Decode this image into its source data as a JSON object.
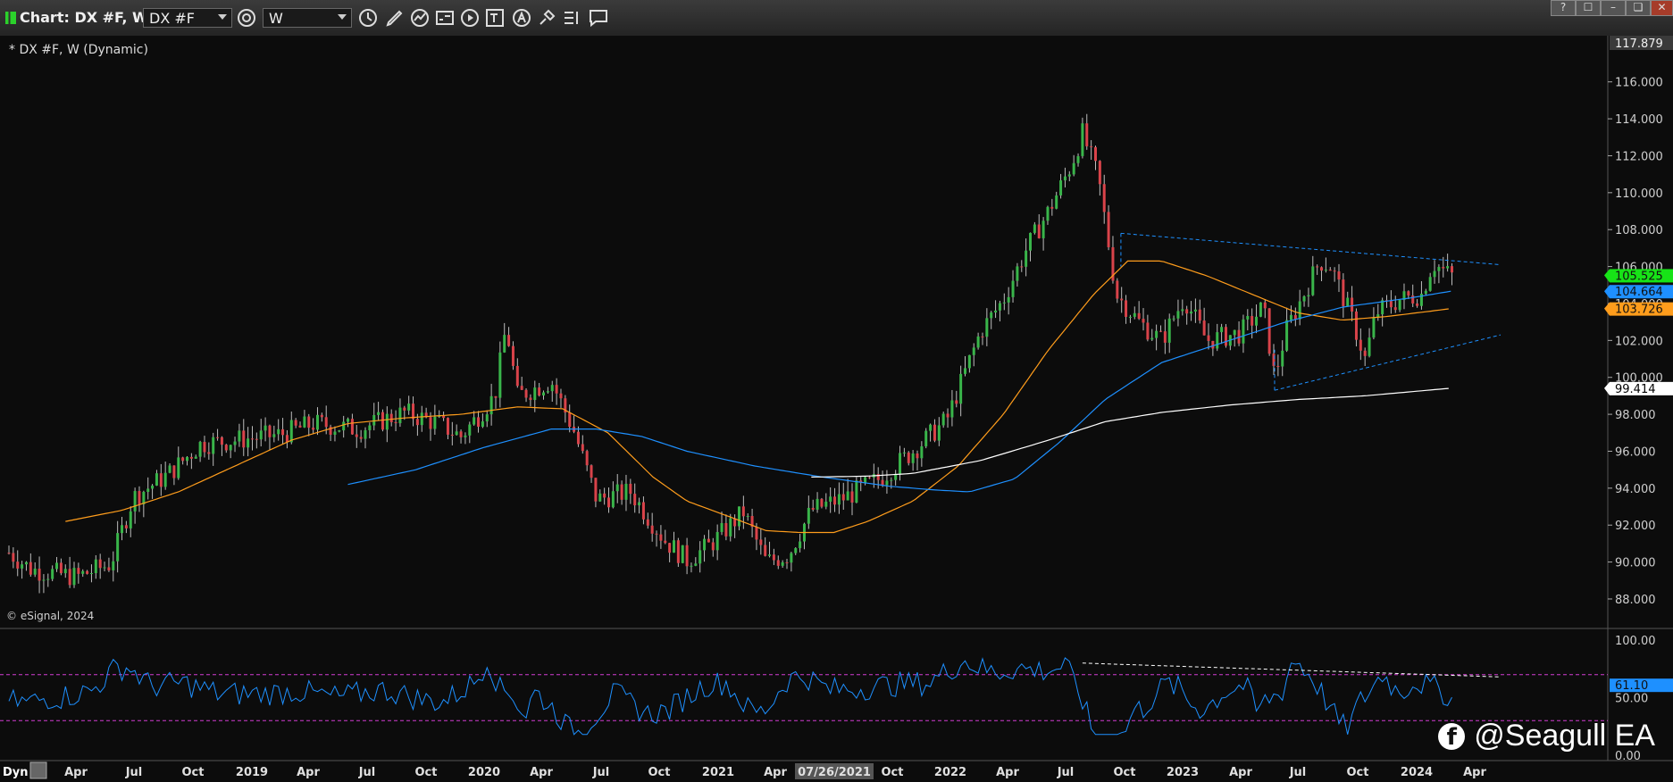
{
  "window": {
    "title": "Chart: DX #F, W",
    "symbol_value": "DX #F",
    "interval_value": "W",
    "buttons": [
      "?",
      "☐",
      "–",
      "❏",
      "✕"
    ]
  },
  "toolbar": {
    "icons": [
      "clock-gear-icon",
      "clock-icon",
      "pencil-icon",
      "line-tool-icon",
      "study-icon",
      "play-icon",
      "text-tool-icon",
      "alert-icon",
      "cursor-icon",
      "list-icon",
      "comment-icon"
    ]
  },
  "chart_data": {
    "type": "candlestick",
    "title": "* DX #F, W (Dynamic)",
    "copyright": "© eSignal, 2024",
    "price_axis": {
      "ticks": [
        "88.000",
        "90.000",
        "92.000",
        "94.000",
        "96.000",
        "98.000",
        "100.000",
        "102.000",
        "104.000",
        "106.000",
        "108.000",
        "110.000",
        "112.000",
        "114.000",
        "116.000"
      ],
      "ylim": [
        86.5,
        118.5
      ],
      "top_label": "117.879",
      "markers": [
        {
          "label": "105.525",
          "color": "#17e317"
        },
        {
          "label": "104.664",
          "color": "#1e90ff"
        },
        {
          "label": "103.726",
          "color": "#ff9d1c"
        },
        {
          "label": "99.414",
          "color": "#ffffff"
        }
      ]
    },
    "time_axis": {
      "labels": [
        "Apr",
        "Jul",
        "Oct",
        "2019",
        "Apr",
        "Jul",
        "Oct",
        "2020",
        "Apr",
        "Jul",
        "Oct",
        "2021",
        "Apr",
        "07/26/2021",
        "Oct",
        "2022",
        "Apr",
        "Jul",
        "Oct",
        "2023",
        "Apr",
        "Jul",
        "Oct",
        "2024",
        "Apr"
      ],
      "tag": "Dyn",
      "cursor_label": "07/26/2021",
      "x_range": [
        "2018-01",
        "2024-06"
      ]
    },
    "series": [
      {
        "name": "",
        "type": "close",
        "color": "#2fa83a",
        "anchors": [
          [
            2018.0,
            90.5
          ],
          [
            2018.1,
            89.6
          ],
          [
            2018.3,
            89.2
          ],
          [
            2018.45,
            89.9
          ],
          [
            2018.55,
            93.5
          ],
          [
            2018.7,
            94.7
          ],
          [
            2018.85,
            96.4
          ],
          [
            2019.0,
            96.6
          ],
          [
            2019.2,
            96.9
          ],
          [
            2019.35,
            97.5
          ],
          [
            2019.55,
            97.2
          ],
          [
            2019.75,
            98.1
          ],
          [
            2019.9,
            97.5
          ],
          [
            2020.0,
            96.8
          ],
          [
            2020.15,
            99.0
          ],
          [
            2020.2,
            102.8
          ],
          [
            2020.25,
            99.0
          ],
          [
            2020.4,
            99.8
          ],
          [
            2020.5,
            97.1
          ],
          [
            2020.6,
            93.4
          ],
          [
            2020.75,
            93.8
          ],
          [
            2020.9,
            91.2
          ],
          [
            2021.0,
            90.1
          ],
          [
            2021.1,
            90.9
          ],
          [
            2021.25,
            92.7
          ],
          [
            2021.35,
            90.0
          ],
          [
            2021.45,
            90.4
          ],
          [
            2021.55,
            92.8
          ],
          [
            2021.7,
            93.5
          ],
          [
            2021.85,
            94.5
          ],
          [
            2022.0,
            96.0
          ],
          [
            2022.15,
            97.7
          ],
          [
            2022.3,
            102.5
          ],
          [
            2022.4,
            104.2
          ],
          [
            2022.5,
            106.9
          ],
          [
            2022.6,
            109.0
          ],
          [
            2022.7,
            111.5
          ],
          [
            2022.75,
            113.2
          ],
          [
            2022.82,
            110.8
          ],
          [
            2022.9,
            104.5
          ],
          [
            2023.0,
            103.0
          ],
          [
            2023.1,
            102.0
          ],
          [
            2023.2,
            104.3
          ],
          [
            2023.3,
            102.0
          ],
          [
            2023.45,
            102.4
          ],
          [
            2023.55,
            103.8
          ],
          [
            2023.6,
            100.0
          ],
          [
            2023.65,
            102.5
          ],
          [
            2023.8,
            106.3
          ],
          [
            2023.85,
            106.0
          ],
          [
            2023.95,
            102.9
          ],
          [
            2024.0,
            101.0
          ],
          [
            2024.05,
            103.5
          ],
          [
            2024.15,
            104.2
          ],
          [
            2024.25,
            104.5
          ],
          [
            2024.3,
            106.2
          ],
          [
            2024.38,
            105.5
          ]
        ]
      },
      {
        "name": "",
        "type": "ma",
        "color": "#ff9d1c",
        "anchors": [
          [
            2018.25,
            92.2
          ],
          [
            2018.5,
            92.8
          ],
          [
            2018.75,
            93.8
          ],
          [
            2019.0,
            95.2
          ],
          [
            2019.25,
            96.6
          ],
          [
            2019.5,
            97.5
          ],
          [
            2019.75,
            97.8
          ],
          [
            2020.0,
            98.0
          ],
          [
            2020.25,
            98.4
          ],
          [
            2020.45,
            98.3
          ],
          [
            2020.65,
            97.0
          ],
          [
            2020.85,
            94.6
          ],
          [
            2021.0,
            93.3
          ],
          [
            2021.2,
            92.4
          ],
          [
            2021.35,
            91.7
          ],
          [
            2021.5,
            91.6
          ],
          [
            2021.65,
            91.6
          ],
          [
            2021.8,
            92.2
          ],
          [
            2022.0,
            93.3
          ],
          [
            2022.2,
            95.2
          ],
          [
            2022.4,
            98.0
          ],
          [
            2022.6,
            101.5
          ],
          [
            2022.8,
            104.5
          ],
          [
            2022.95,
            106.3
          ],
          [
            2023.1,
            106.3
          ],
          [
            2023.3,
            105.5
          ],
          [
            2023.5,
            104.5
          ],
          [
            2023.7,
            103.5
          ],
          [
            2023.9,
            103.1
          ],
          [
            2024.1,
            103.3
          ],
          [
            2024.3,
            103.6
          ],
          [
            2024.38,
            103.726
          ]
        ]
      },
      {
        "name": "",
        "type": "ma",
        "color": "#1e90ff",
        "anchors": [
          [
            2019.5,
            94.2
          ],
          [
            2019.8,
            95.0
          ],
          [
            2020.1,
            96.2
          ],
          [
            2020.4,
            97.2
          ],
          [
            2020.6,
            97.2
          ],
          [
            2020.8,
            96.8
          ],
          [
            2021.0,
            96.0
          ],
          [
            2021.3,
            95.2
          ],
          [
            2021.6,
            94.6
          ],
          [
            2021.9,
            94.1
          ],
          [
            2022.1,
            93.9
          ],
          [
            2022.25,
            93.8
          ],
          [
            2022.45,
            94.5
          ],
          [
            2022.65,
            96.5
          ],
          [
            2022.85,
            98.8
          ],
          [
            2023.1,
            100.8
          ],
          [
            2023.4,
            102.0
          ],
          [
            2023.65,
            103.0
          ],
          [
            2023.9,
            103.8
          ],
          [
            2024.2,
            104.3
          ],
          [
            2024.38,
            104.664
          ]
        ]
      },
      {
        "name": "",
        "type": "ma",
        "color": "#ffffff",
        "anchors": [
          [
            2021.55,
            94.6
          ],
          [
            2021.8,
            94.65
          ],
          [
            2022.0,
            94.8
          ],
          [
            2022.3,
            95.5
          ],
          [
            2022.6,
            96.6
          ],
          [
            2022.85,
            97.6
          ],
          [
            2023.1,
            98.1
          ],
          [
            2023.4,
            98.5
          ],
          [
            2023.7,
            98.8
          ],
          [
            2024.0,
            99.0
          ],
          [
            2024.38,
            99.414
          ]
        ]
      }
    ],
    "trendlines": [
      {
        "from": [
          2022.92,
          107.8
        ],
        "to": [
          2024.6,
          106.1
        ],
        "color": "#1e90ff",
        "style": "dashed"
      },
      {
        "from": [
          2023.6,
          99.3
        ],
        "to": [
          2024.6,
          102.3
        ],
        "color": "#1e90ff",
        "style": "dashed"
      },
      {
        "from": [
          2023.6,
          99.3
        ],
        "to": [
          2023.6,
          101.5
        ],
        "color": "#1e90ff",
        "style": "dashed"
      },
      {
        "from": [
          2022.92,
          107.8
        ],
        "to": [
          2022.92,
          106.0
        ],
        "color": "#1e90ff",
        "style": "dashed"
      }
    ],
    "oscillator": {
      "type": "line",
      "color": "#1e90ff",
      "ticks": [
        "100.00",
        "50.00",
        "0.00"
      ],
      "ylim": [
        0,
        100
      ],
      "levels": [
        70,
        30
      ],
      "level_color": "#d23bd2",
      "marker": {
        "label": "61.10",
        "color": "#1e90ff"
      },
      "divergence_line": {
        "from": [
          2022.75,
          80
        ],
        "to": [
          2024.6,
          68
        ],
        "color": "#ffffff"
      }
    }
  },
  "watermark": {
    "text": "@Seagull EA"
  }
}
